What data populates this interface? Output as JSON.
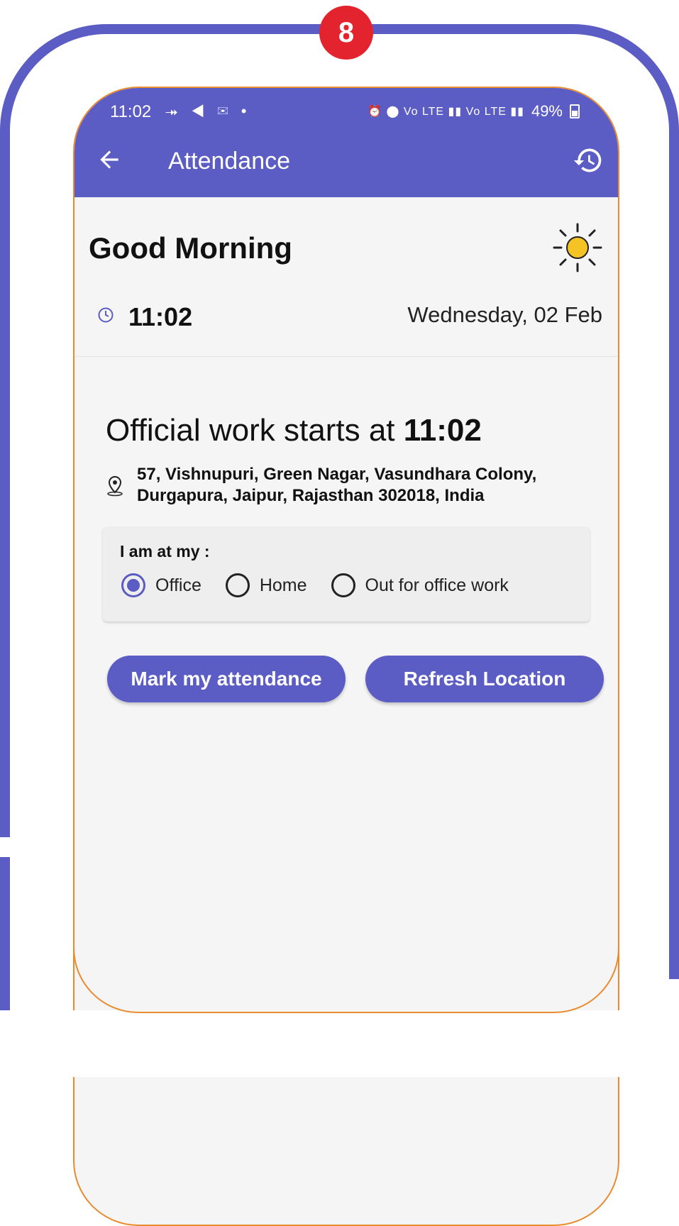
{
  "badge": {
    "number": "8"
  },
  "status_bar": {
    "time": "11:02",
    "left_icons": "⯮ ◀ ✉ •",
    "right_icons": "⏰ ⬤ Vo LTE ▮▮ Vo LTE ▮▮",
    "battery": "49%"
  },
  "header": {
    "title": "Attendance"
  },
  "greeting": {
    "text": "Good Morning"
  },
  "clock": {
    "time": "11:02",
    "date": "Wednesday, 02 Feb"
  },
  "work": {
    "prefix": "Official work starts at",
    "time": "11:02",
    "address": "57, Vishnupuri, Green Nagar, Vasundhara Colony, Durgapura, Jaipur, Rajasthan 302018, India"
  },
  "location_card": {
    "label": "I am at my :",
    "options": [
      {
        "label": "Office",
        "selected": true
      },
      {
        "label": "Home",
        "selected": false
      },
      {
        "label": "Out for office work",
        "selected": false
      }
    ]
  },
  "actions": {
    "mark_label": "Mark my attendance",
    "refresh_label": "Refresh Location"
  },
  "colors": {
    "primary": "#5b5cc4",
    "badge": "#e3242f",
    "device_border": "#e98b2f",
    "sun": "#f6c324"
  }
}
